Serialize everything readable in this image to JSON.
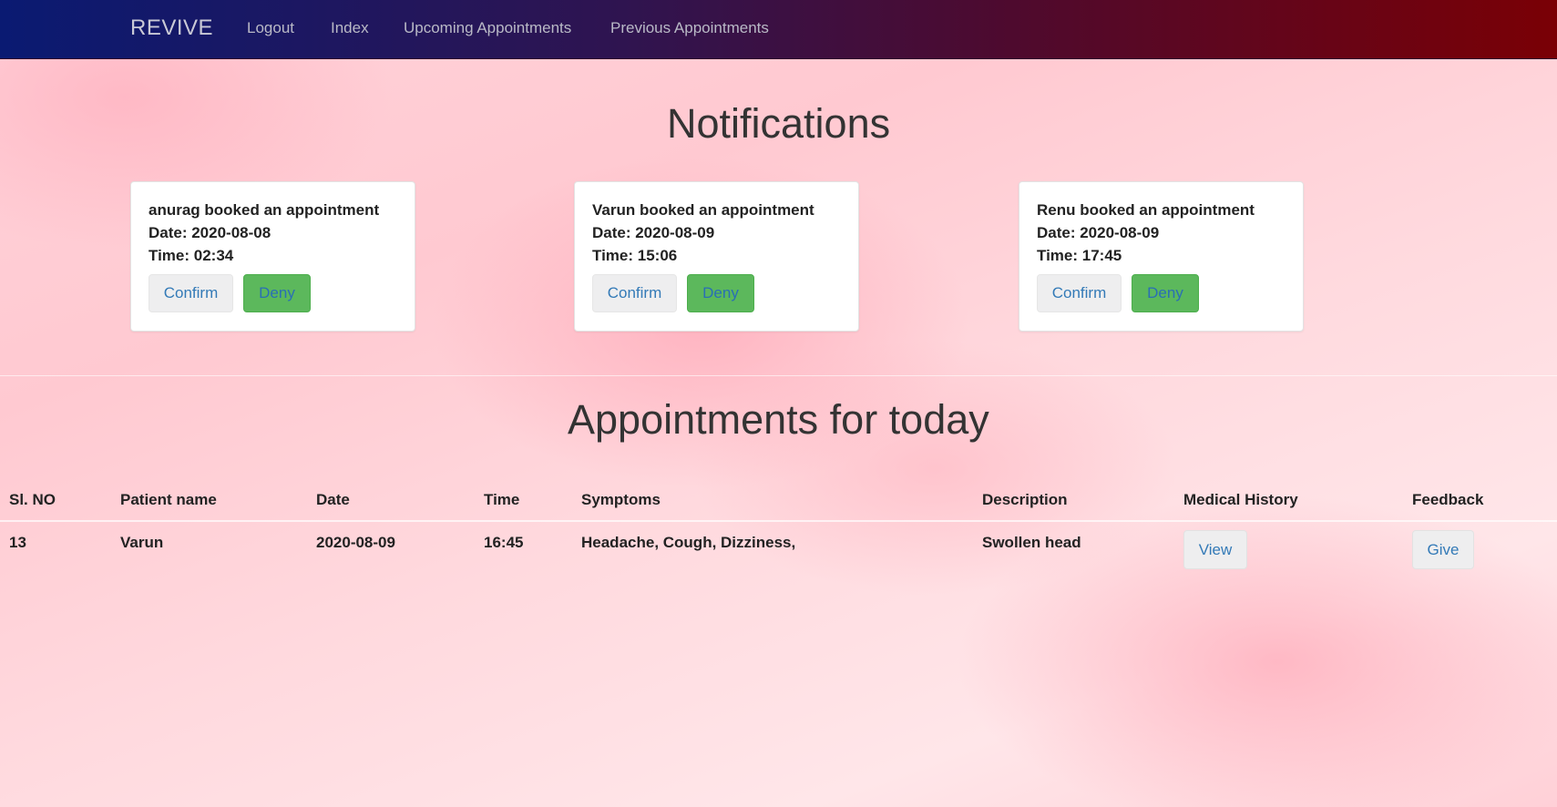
{
  "navbar": {
    "brand": "REVIVE",
    "links": [
      "Logout",
      "Index",
      "Upcoming Appointments",
      "Previous Appointments"
    ]
  },
  "notifications": {
    "title": "Notifications",
    "cards": [
      {
        "message": "anurag booked an appointment",
        "date": "Date: 2020-08-08",
        "time": "Time: 02:34",
        "confirm_label": "Confirm",
        "deny_label": "Deny"
      },
      {
        "message": "Varun booked an appointment",
        "date": "Date: 2020-08-09",
        "time": "Time: 15:06",
        "confirm_label": "Confirm",
        "deny_label": "Deny"
      },
      {
        "message": "Renu booked an appointment",
        "date": "Date: 2020-08-09",
        "time": "Time: 17:45",
        "confirm_label": "Confirm",
        "deny_label": "Deny"
      }
    ]
  },
  "appointments": {
    "title": "Appointments for today",
    "headers": [
      "Sl. NO",
      "Patient name",
      "Date",
      "Time",
      "Symptoms",
      "Description",
      "Medical History",
      "Feedback"
    ],
    "rows": [
      {
        "sl_no": "13",
        "patient": "Varun",
        "date": "2020-08-09",
        "time": "16:45",
        "symptoms": "Headache, Cough, Dizziness,",
        "description": "Swollen head",
        "history_label": "View",
        "feedback_label": "Give"
      }
    ]
  },
  "colors": {
    "accent_link": "#337ab7",
    "deny_button": "#5cb85c",
    "navbar_start": "#0a1a72",
    "navbar_end": "#7a0005"
  }
}
